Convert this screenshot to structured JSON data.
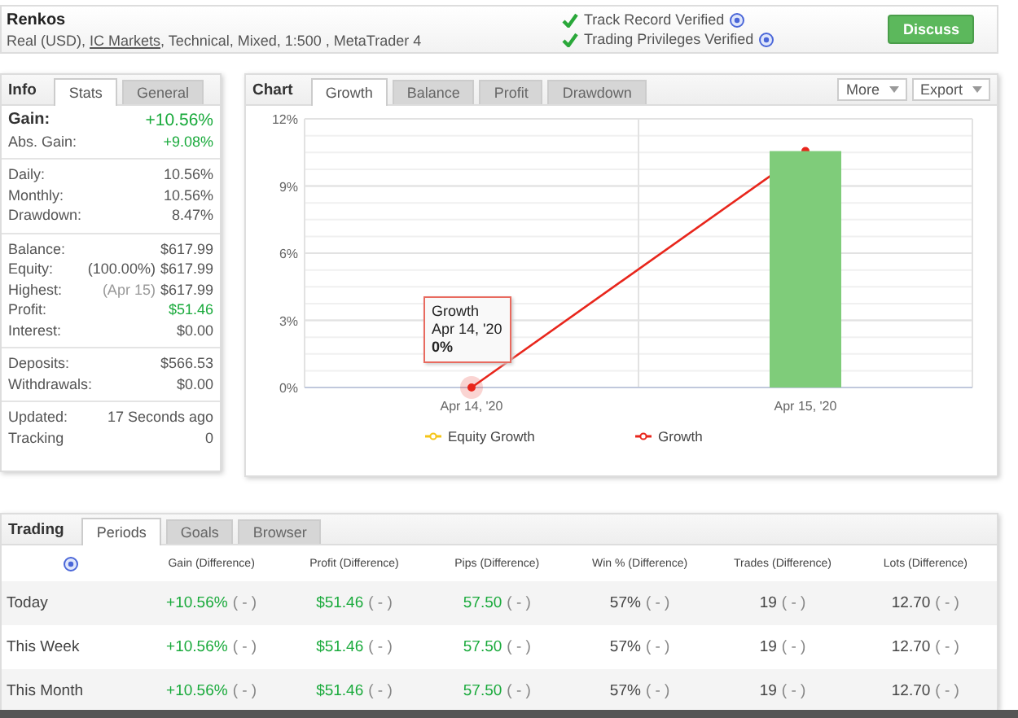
{
  "header": {
    "title": "Renkos",
    "subtitle_start": "Real (USD), ",
    "broker_link": "IC Markets",
    "subtitle_end": ", Technical, Mixed, 1:500 , MetaTrader 4",
    "verifications": [
      {
        "label": "Track Record Verified",
        "verified": true
      },
      {
        "label": "Trading Privileges Verified",
        "verified": true
      }
    ],
    "discuss_button": "Discuss"
  },
  "info": {
    "title": "Info",
    "tabs": [
      {
        "label": "Stats",
        "selected": true
      },
      {
        "label": "General",
        "selected": false
      }
    ],
    "groups": [
      {
        "rows": [
          {
            "label": "Gain:",
            "value": "+10.56%",
            "positive": true,
            "emphasis": true
          },
          {
            "label": "Abs. Gain:",
            "value": "+9.08%",
            "positive": true,
            "emphasis": false
          }
        ]
      },
      {
        "rows": [
          {
            "label": "Daily:",
            "value": "10.56%",
            "positive": false,
            "emphasis": false
          },
          {
            "label": "Monthly:",
            "value": "10.56%",
            "positive": false,
            "emphasis": false
          },
          {
            "label": "Drawdown:",
            "value": "8.47%",
            "positive": false,
            "emphasis": false
          }
        ]
      },
      {
        "rows": [
          {
            "label": "Balance:",
            "value": "$617.99",
            "positive": false,
            "emphasis": false
          },
          {
            "label": "Equity:",
            "note": "(100.00%)",
            "muted_note": false,
            "value": "$617.99",
            "positive": false,
            "emphasis": false
          },
          {
            "label": "Highest:",
            "note": "(Apr 15)",
            "muted_note": true,
            "value": "$617.99",
            "positive": false,
            "emphasis": false
          },
          {
            "label": "Profit:",
            "value": "$51.46",
            "positive": true,
            "emphasis": false
          },
          {
            "label": "Interest:",
            "value": "$0.00",
            "positive": false,
            "emphasis": false
          }
        ]
      },
      {
        "rows": [
          {
            "label": "Deposits:",
            "value": "$566.53",
            "positive": false,
            "emphasis": false
          },
          {
            "label": "Withdrawals:",
            "value": "$0.00",
            "positive": false,
            "emphasis": false
          }
        ]
      },
      {
        "rows": [
          {
            "label": "Updated:",
            "value": "17 Seconds ago",
            "positive": false,
            "emphasis": false
          },
          {
            "label": "Tracking",
            "value": "0",
            "positive": false,
            "emphasis": false
          }
        ]
      }
    ]
  },
  "chart_panel": {
    "title": "Chart",
    "tabs": [
      {
        "label": "Growth",
        "selected": true
      },
      {
        "label": "Balance",
        "selected": false
      },
      {
        "label": "Profit",
        "selected": false
      },
      {
        "label": "Drawdown",
        "selected": false
      }
    ],
    "menus": [
      "More",
      "Export"
    ],
    "chart_data": {
      "type": "line",
      "categories": [
        "Apr 14, '20",
        "Apr 15, '20"
      ],
      "ylim": [
        0,
        12
      ],
      "yticks": [
        {
          "value": 0,
          "label": "0%"
        },
        {
          "value": 3,
          "label": "3%"
        },
        {
          "value": 6,
          "label": "6%"
        },
        {
          "value": 9,
          "label": "9%"
        },
        {
          "value": 12,
          "label": "12%"
        }
      ],
      "grid": true,
      "series": [
        {
          "name": "Equity Growth",
          "color": "#f5c518",
          "values": [
            null,
            null
          ],
          "marker": "circle"
        },
        {
          "name": "Growth",
          "color": "#e8261c",
          "values": [
            0,
            10.56
          ],
          "marker": "circle"
        },
        {
          "color": "#7fcc7a",
          "values": [
            null,
            10.56
          ],
          "type": "bar"
        }
      ]
    },
    "tooltip": {
      "title": "Growth",
      "date": "Apr 14, '20",
      "value": "0%"
    }
  },
  "trading": {
    "title": "Trading",
    "tabs": [
      {
        "label": "Periods",
        "selected": true
      },
      {
        "label": "Goals",
        "selected": false
      },
      {
        "label": "Browser",
        "selected": false
      }
    ],
    "columns": [
      "Gain (Difference)",
      "Profit (Difference)",
      "Pips (Difference)",
      "Win % (Difference)",
      "Trades (Difference)",
      "Lots (Difference)"
    ],
    "rows": [
      {
        "label": "Today",
        "cells": [
          {
            "value": "+10.56%",
            "diff": "( - )",
            "positive": true
          },
          {
            "value": "$51.46",
            "diff": "( - )",
            "positive": true
          },
          {
            "value": "57.50",
            "diff": "( - )",
            "positive": true
          },
          {
            "value": "57%",
            "diff": "( - )",
            "positive": false
          },
          {
            "value": "19",
            "diff": "( - )",
            "positive": false
          },
          {
            "value": "12.70",
            "diff": "( - )",
            "positive": false
          }
        ]
      },
      {
        "label": "This Week",
        "cells": [
          {
            "value": "+10.56%",
            "diff": "( - )",
            "positive": true
          },
          {
            "value": "$51.46",
            "diff": "( - )",
            "positive": true
          },
          {
            "value": "57.50",
            "diff": "( - )",
            "positive": true
          },
          {
            "value": "57%",
            "diff": "( - )",
            "positive": false
          },
          {
            "value": "19",
            "diff": "( - )",
            "positive": false
          },
          {
            "value": "12.70",
            "diff": "( - )",
            "positive": false
          }
        ]
      },
      {
        "label": "This Month",
        "cells": [
          {
            "value": "+10.56%",
            "diff": "( - )",
            "positive": true
          },
          {
            "value": "$51.46",
            "diff": "( - )",
            "positive": true
          },
          {
            "value": "57.50",
            "diff": "( - )",
            "positive": true
          },
          {
            "value": "57%",
            "diff": "( - )",
            "positive": false
          },
          {
            "value": "19",
            "diff": "( - )",
            "positive": false
          },
          {
            "value": "12.70",
            "diff": "( - )",
            "positive": false
          }
        ]
      }
    ]
  }
}
